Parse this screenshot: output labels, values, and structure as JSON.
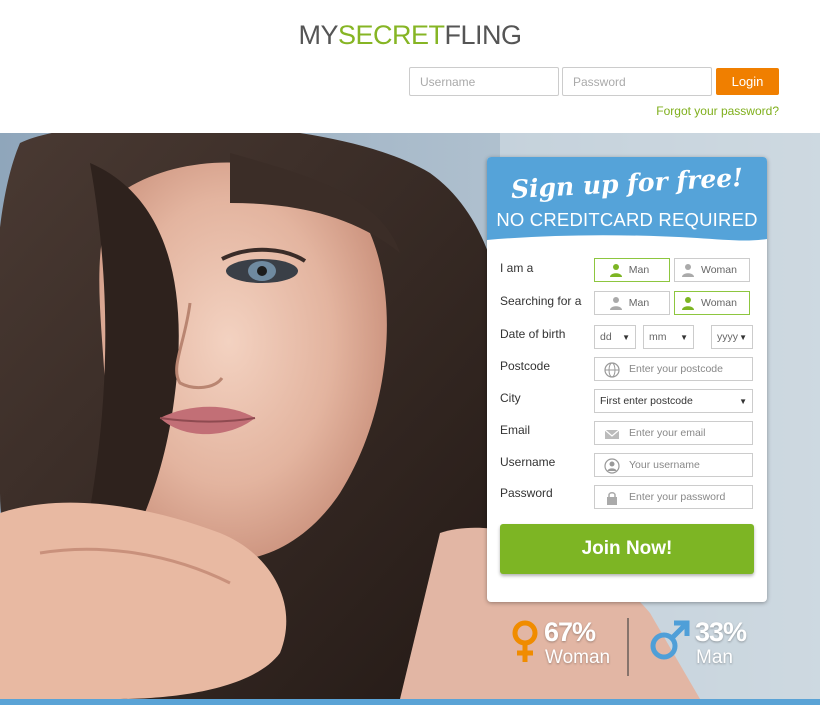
{
  "header": {
    "logo": {
      "part1": "MY",
      "part2": "SECRET",
      "part3": "FLING"
    },
    "username_placeholder": "Username",
    "password_placeholder": "Password",
    "login_label": "Login",
    "forgot_label": "Forgot your password?"
  },
  "signup": {
    "title": "Sign up for free!",
    "subtitle": "NO CREDITCARD REQUIRED",
    "iam_label": "I am a",
    "iam_options": [
      "Man",
      "Woman"
    ],
    "iam_selected": "Man",
    "searching_label": "Searching for a",
    "searching_options": [
      "Man",
      "Woman"
    ],
    "searching_selected": "Woman",
    "dob_label": "Date of birth",
    "dob_day": "dd",
    "dob_month": "mm",
    "dob_year": "yyyy",
    "postcode_label": "Postcode",
    "postcode_placeholder": "Enter your postcode",
    "city_label": "City",
    "city_value": "First enter postcode",
    "email_label": "Email",
    "email_placeholder": "Enter your email",
    "username_label": "Username",
    "username_placeholder": "Your username",
    "password_label": "Password",
    "password_placeholder": "Enter your password",
    "join_label": "Join Now!"
  },
  "stats": {
    "women_pct": "67%",
    "women_label": "Woman",
    "men_pct": "33%",
    "men_label": "Man"
  },
  "colors": {
    "brand_green": "#86b524",
    "login_orange": "#f07f00",
    "card_blue": "#55a3d9",
    "female_orange": "#f08c00",
    "male_blue": "#4f9fd8"
  }
}
